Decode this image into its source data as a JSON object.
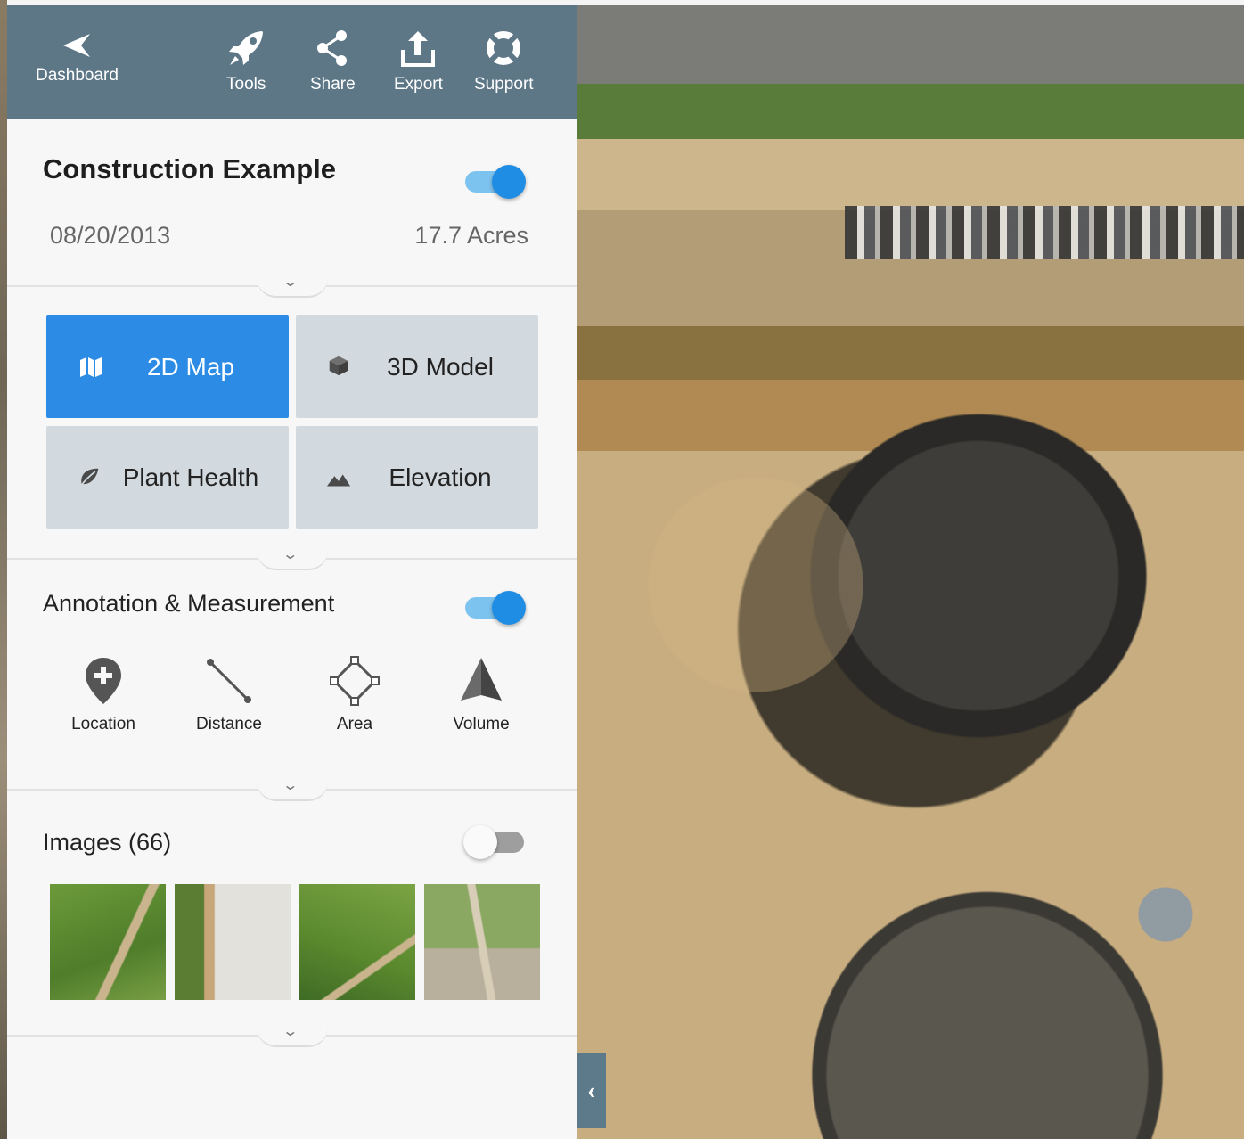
{
  "nav": {
    "dashboard": "Dashboard",
    "tools": "Tools",
    "share": "Share",
    "export": "Export",
    "support": "Support"
  },
  "project": {
    "title": "Construction Example",
    "date": "08/20/2013",
    "area": "17.7 Acres",
    "visible": true
  },
  "views": {
    "map2d": "2D Map",
    "model3d": "3D Model",
    "plant_health": "Plant Health",
    "elevation": "Elevation",
    "active": "2D Map"
  },
  "annotation": {
    "title": "Annotation & Measurement",
    "enabled": true,
    "tools": {
      "location": "Location",
      "distance": "Distance",
      "area": "Area",
      "volume": "Volume"
    }
  },
  "images": {
    "title": "Images (66)",
    "enabled": false
  },
  "colors": {
    "header": "#5d7787",
    "accent": "#2b8be5",
    "tile": "#d3dadf"
  },
  "icons": [
    "back-arrow-icon",
    "rocket-icon",
    "share-icon",
    "export-icon",
    "support-icon",
    "map-icon",
    "cube-icon",
    "leaf-icon",
    "mountain-icon",
    "location-pin-icon",
    "distance-line-icon",
    "area-polygon-icon",
    "volume-pyramid-icon",
    "chevron-down-icon",
    "chevron-left-icon"
  ]
}
